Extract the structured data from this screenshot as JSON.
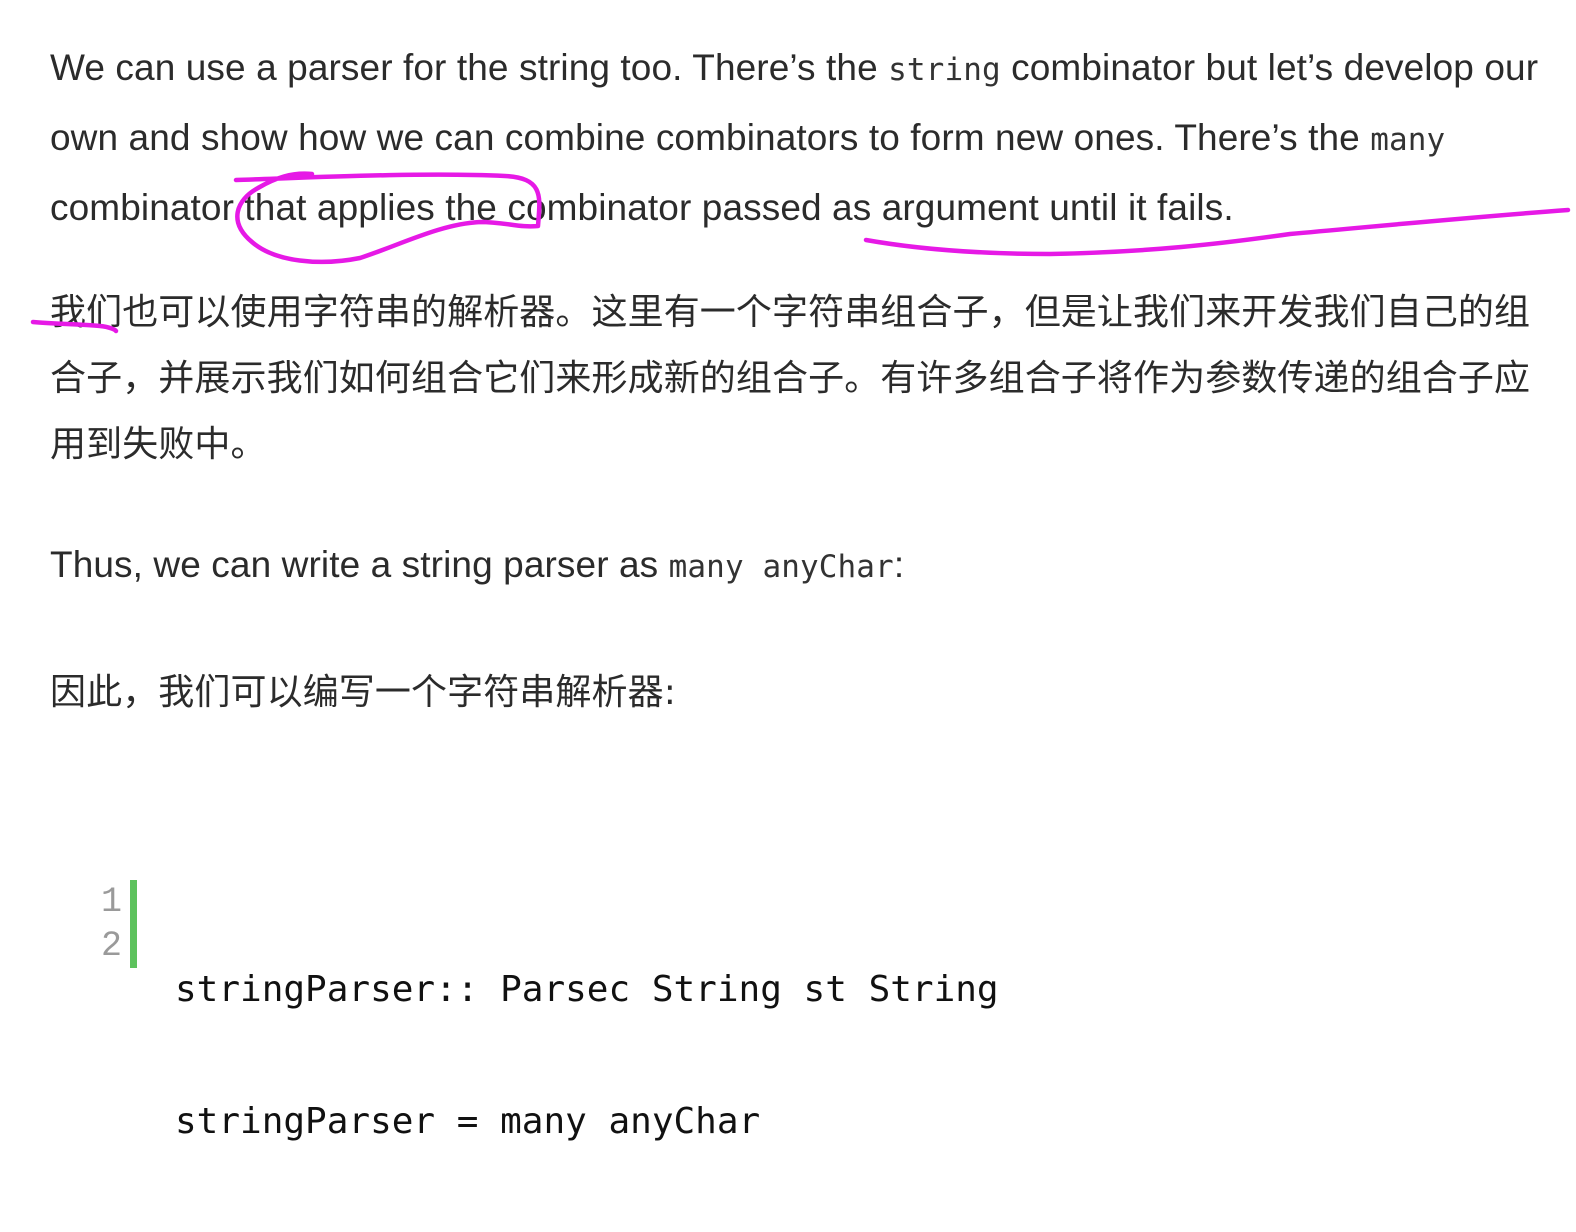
{
  "article": {
    "p1": {
      "before_string": "We can use a parser for the string too. There’s the ",
      "code_string": "string",
      "after_string": " combinator but let’s develop our own and show how we can combine combinators to form new ones. There’s the ",
      "code_many": "many",
      "after_many": " combinator that applies the combinator passed as argument until it fails."
    },
    "p1_zh": "我们也可以使用字符串的解析器。这里有一个字符串组合子，但是让我们来开发我们自己的组合子，并展示我们如何组合它们来形成新的组合子。有许多组合子将作为参数传递的组合子应用到失败中。",
    "p2": {
      "before": "Thus, we can write a string parser as ",
      "code": "many anyChar",
      "after": ":"
    },
    "p2_zh": "因此，我们可以编写一个字符串解析器:"
  },
  "code_block": {
    "line_numbers": [
      "1",
      "2"
    ],
    "lines": [
      "stringParser:: Parsec String st String",
      "stringParser = many anyChar"
    ]
  },
  "annotation_color": "#e619e6"
}
